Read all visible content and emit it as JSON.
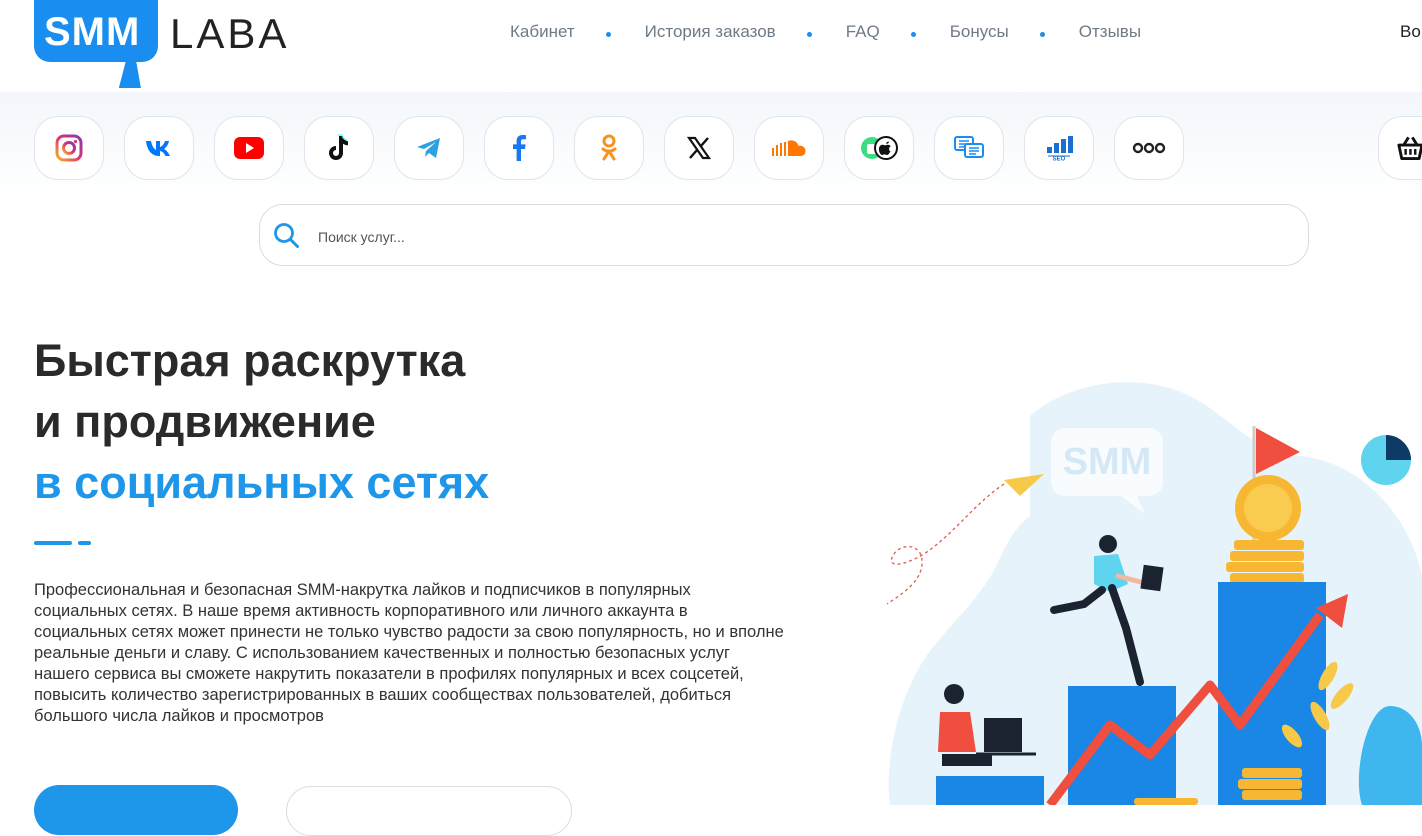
{
  "header": {
    "logo_box": "SMM",
    "logo_text": "LABA",
    "nav": [
      "Кабинет",
      "История заказов",
      "FAQ",
      "Бонусы",
      "Отзывы"
    ],
    "login_label": "Во"
  },
  "socials": [
    {
      "name": "instagram-icon",
      "color": "#e1306c"
    },
    {
      "name": "vk-icon",
      "color": "#0077ff"
    },
    {
      "name": "youtube-icon",
      "color": "#ff0000"
    },
    {
      "name": "tiktok-icon",
      "color": "#000000"
    },
    {
      "name": "telegram-icon",
      "color": "#2aa3e0"
    },
    {
      "name": "facebook-icon",
      "color": "#1877f2"
    },
    {
      "name": "odnoklassniki-icon",
      "color": "#f7931e"
    },
    {
      "name": "x-icon",
      "color": "#000000"
    },
    {
      "name": "soundcloud-icon",
      "color": "#ff7700"
    },
    {
      "name": "android-apple-icon",
      "color": "#3ddc84"
    },
    {
      "name": "messages-icon",
      "color": "#1a8ef0"
    },
    {
      "name": "seo-icon",
      "color": "#1a6fd0"
    },
    {
      "name": "more-icon",
      "color": "#222222"
    },
    {
      "name": "basket-icon",
      "color": "#222222"
    }
  ],
  "search": {
    "placeholder": "Поиск услуг..."
  },
  "hero": {
    "title_line1": "Быстрая раскрутка",
    "title_line2": "и продвижение",
    "title_line3": "в социальных сетях",
    "description": "Профессиональная и безопасная SMM-накрутка лайков и подписчиков в популярных социальных сетях. В наше время активность корпоративного или личного аккаунта в социальных сетях может принести не только чувство радости за свою популярность, но и вполне реальные деньги и славу. С использованием качественных и полностью безопасных услуг нашего сервиса вы сможете накрутить показатели в профилях популярных и всех соцсетей, повысить количество зарегистрированных в ваших сообществах пользователей, добиться большого числа лайков и просмотров",
    "illustration_label": "SMM"
  },
  "colors": {
    "accent": "#1e96ea",
    "brand": "#1a8ef0",
    "text": "#2a2a2a"
  }
}
